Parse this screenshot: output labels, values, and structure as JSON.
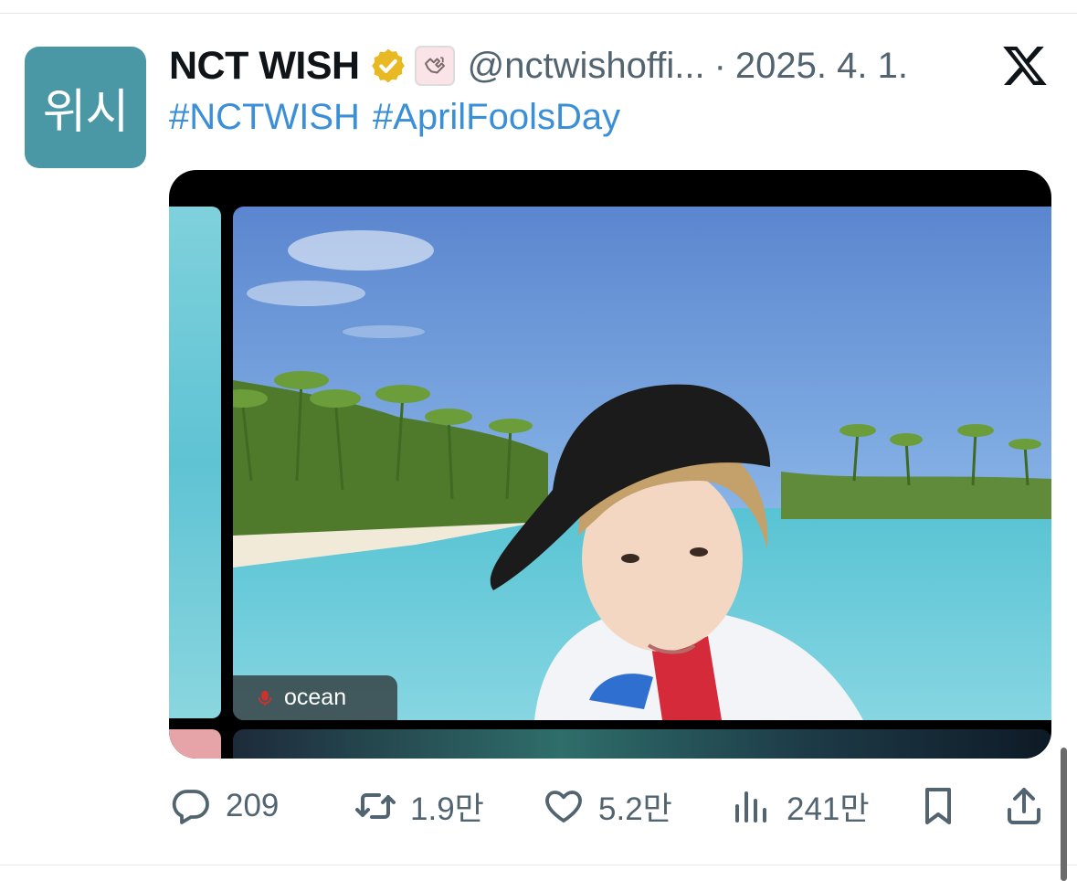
{
  "tweet": {
    "avatar_text": "위시",
    "display_name": "NCT WISH",
    "handle": "@nctwishoffi...",
    "separator": "·",
    "date": "2025. 4. 1.",
    "hashtags": [
      "#NCTWISH",
      "#AprilFoolsDay"
    ],
    "media": {
      "participant_label": "ocean"
    },
    "actions": {
      "replies": "209",
      "retweets": "1.9만",
      "likes": "5.2만",
      "views": "241만"
    }
  },
  "icons": {
    "verified": "verified-gold-badge-icon",
    "affiliate": "affiliate-badge-icon",
    "brand": "x-logo-icon",
    "reply": "reply-icon",
    "retweet": "retweet-icon",
    "like": "heart-icon",
    "views": "views-chart-icon",
    "bookmark": "bookmark-icon",
    "share": "share-icon"
  },
  "colors": {
    "avatar_bg": "#4a98a6",
    "hashtag": "#3b8fd6",
    "verified_gold": "#e8b923",
    "muted_text": "#536471"
  }
}
